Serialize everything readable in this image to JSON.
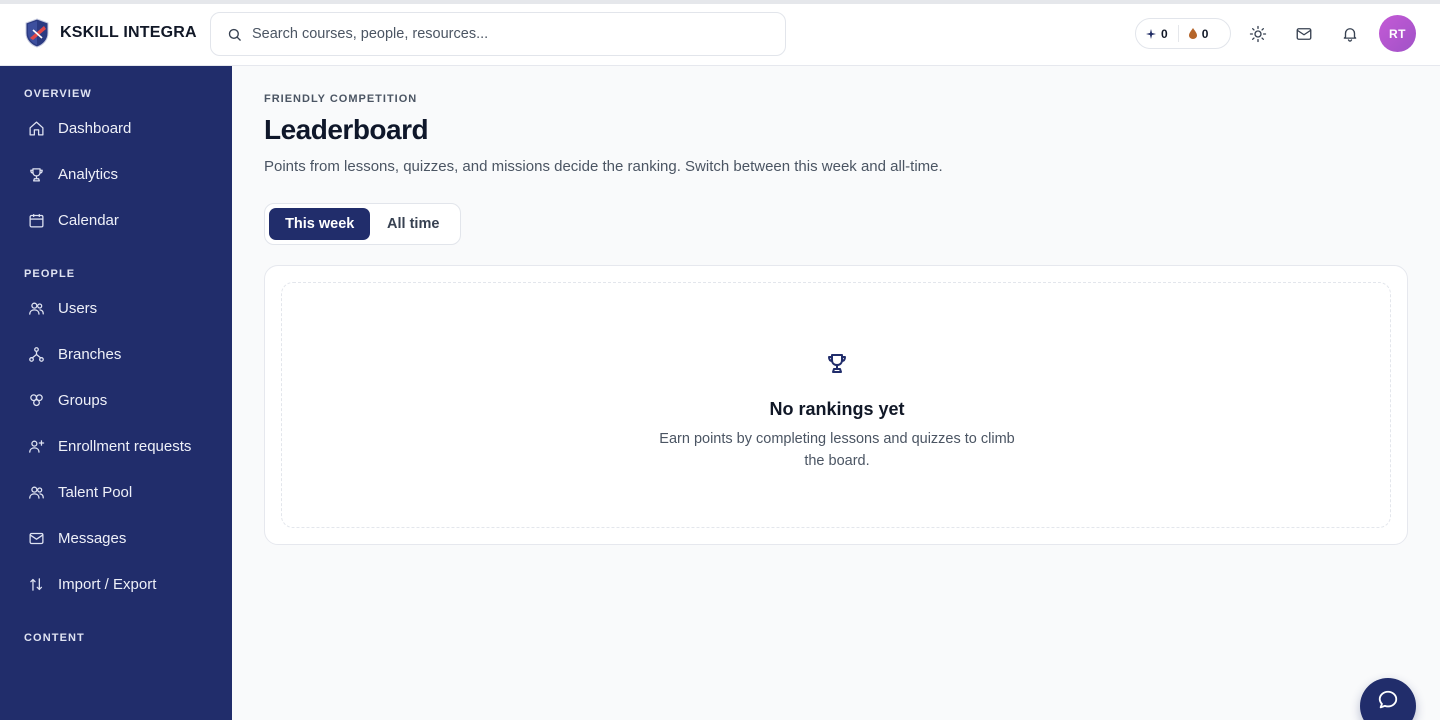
{
  "brand": {
    "name": "KSKILL INTEGRA"
  },
  "search": {
    "placeholder": "Search courses, people, resources..."
  },
  "header": {
    "sparks": "0",
    "coins": "0",
    "avatar_initials": "RT"
  },
  "sidebar": {
    "sections": [
      {
        "title": "OVERVIEW"
      },
      {
        "title": "PEOPLE"
      },
      {
        "title": "CONTENT"
      }
    ],
    "items": [
      {
        "label": "Dashboard"
      },
      {
        "label": "Analytics"
      },
      {
        "label": "Calendar"
      },
      {
        "label": "Users"
      },
      {
        "label": "Branches"
      },
      {
        "label": "Groups"
      },
      {
        "label": "Enrollment requests"
      },
      {
        "label": "Talent Pool"
      },
      {
        "label": "Messages"
      },
      {
        "label": "Import / Export"
      }
    ]
  },
  "main": {
    "eyebrow": "FRIENDLY COMPETITION",
    "title": "Leaderboard",
    "description": "Points from lessons, quizzes, and missions decide the ranking. Switch between this week and all-time.",
    "tabs": [
      {
        "label": "This week",
        "active": true
      },
      {
        "label": "All time",
        "active": false
      }
    ],
    "empty": {
      "title": "No rankings yet",
      "description": "Earn points by completing lessons and quizzes to climb the board."
    }
  },
  "colors": {
    "sidebar_bg": "#212d6b",
    "accent": "#212d6b",
    "avatar": "#b457d0"
  },
  "icons": {
    "search": "search-icon",
    "sparkle": "sparkle-icon",
    "coin": "coin-icon",
    "theme": "sun-icon",
    "mail": "mail-icon",
    "notifications": "bell-icon",
    "empty": "trophy-icon",
    "chat": "chat-bubble-icon"
  }
}
